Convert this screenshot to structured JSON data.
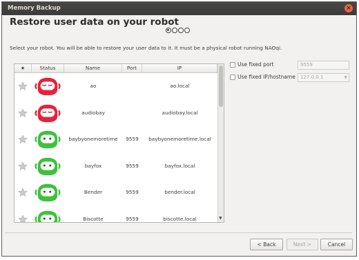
{
  "window": {
    "title": "Memory Backup",
    "close_icon": "close-icon"
  },
  "page": {
    "heading": "Restore user data on your robot",
    "instruction": "Select your robot. You will be able to restore your user data to it. It must be a physical robot running NAOqi."
  },
  "wizard": {
    "total_steps": 4,
    "current_step": 1
  },
  "table": {
    "headers": [
      "★",
      "Status",
      "Name",
      "Port",
      "IP"
    ],
    "rows": [
      {
        "name": "ao",
        "port": "",
        "ip": "ao.local",
        "status": "red"
      },
      {
        "name": "audiobay",
        "port": "",
        "ip": "audiobay.local",
        "status": "red"
      },
      {
        "name": "baybyonemoretime",
        "port": "9559",
        "ip": "baybyonemoretime.local",
        "status": "green"
      },
      {
        "name": "bayfox",
        "port": "9559",
        "ip": "bayfox.local",
        "status": "green"
      },
      {
        "name": "Bender",
        "port": "9559",
        "ip": "bender.local",
        "status": "green"
      },
      {
        "name": "Biscotte",
        "port": "9559",
        "ip": "biscotte.local",
        "status": "green"
      }
    ]
  },
  "options": {
    "fixed_port_label": "Use fixed port",
    "fixed_port_value": "9559",
    "fixed_ip_label": "Use fixed IP/hostname",
    "fixed_ip_value": "127.0.0.1"
  },
  "buttons": {
    "back": "< Back",
    "next": "Next >",
    "cancel": "Cancel"
  },
  "colors": {
    "status_red": "#e8213a",
    "status_green": "#3cc23c",
    "close": "#e9653b"
  }
}
